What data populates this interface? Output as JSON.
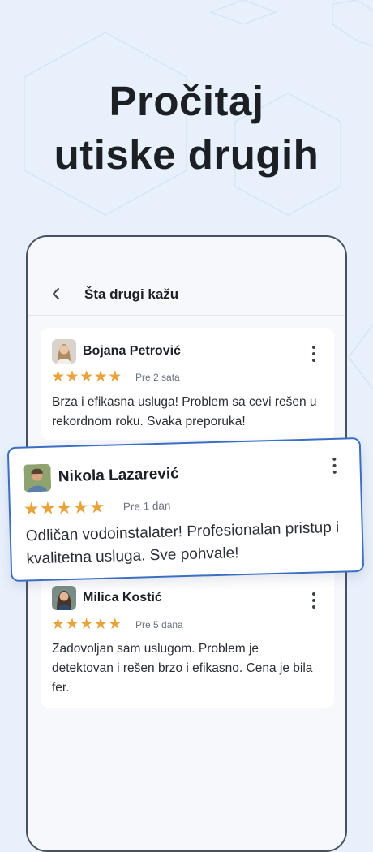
{
  "headline": {
    "line1": "Pročitaj",
    "line2": "utiske drugih"
  },
  "screen": {
    "title": "Šta drugi kažu"
  },
  "reviews": [
    {
      "name": "Bojana Petrović",
      "time": "Pre 2 sata",
      "rating": 5,
      "text": "Brza i efikasna usluga! Problem sa cevi rešen u rekordnom roku. Svaka preporuka!"
    },
    {
      "name": "Nikola Lazarević",
      "time": "Pre 1 dan",
      "rating": 5,
      "text": "Odličan vodoinstalater! Profesionalan pristup i kvalitetna usluga. Sve pohvale!"
    },
    {
      "name": "Milica Kostić",
      "time": "Pre 5 dana",
      "rating": 5,
      "text": "Zadovoljan sam uslugom. Problem je detektovan i rešen brzo i efikasno. Cena je bila fer."
    }
  ],
  "icons": {
    "back": "chevron-left-icon",
    "more": "more-vertical-icon",
    "star": "star-icon"
  },
  "colors": {
    "accent": "#3c6fc4",
    "star": "#e8a33d",
    "background": "#e8f0fb"
  }
}
